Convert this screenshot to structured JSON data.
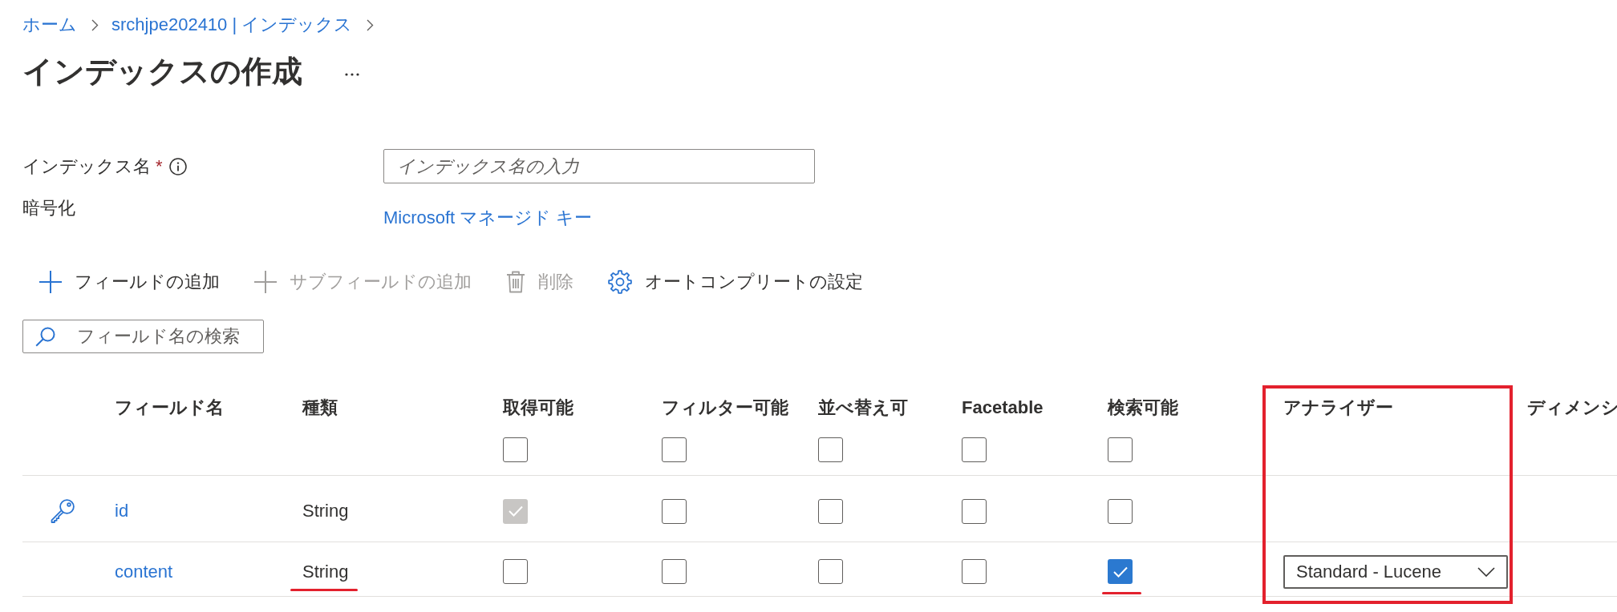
{
  "breadcrumb": [
    {
      "label": "ホーム"
    },
    {
      "label": "srchjpe202410 | インデックス"
    }
  ],
  "title": "インデックスの作成",
  "form": {
    "index_name": {
      "label": "インデックス名",
      "required_mark": "*",
      "placeholder": "インデックス名の入力"
    },
    "encryption": {
      "label": "暗号化",
      "link": "Microsoft マネージド キー"
    }
  },
  "toolbar": [
    {
      "kind": "add",
      "label": "フィールドの追加",
      "disabled": false
    },
    {
      "kind": "add",
      "label": "サブフィールドの追加",
      "disabled": true
    },
    {
      "kind": "delete",
      "label": "削除",
      "disabled": true
    },
    {
      "kind": "settings",
      "label": "オートコンプリートの設定",
      "disabled": false
    }
  ],
  "search": {
    "placeholder": "フィールド名の検索"
  },
  "table": {
    "columns": [
      {
        "label": "フィールド名",
        "kind": "name",
        "highlighted": false
      },
      {
        "label": "種類",
        "kind": "type",
        "highlighted": false
      },
      {
        "label": "取得可能",
        "kind": "checkbox",
        "checked": false,
        "highlighted": false
      },
      {
        "label": "フィルター可能",
        "kind": "checkbox",
        "checked": false,
        "highlighted": false
      },
      {
        "label": "並べ替え可",
        "kind": "checkbox",
        "checked": false,
        "highlighted": false
      },
      {
        "label": "Facetable",
        "kind": "checkbox",
        "checked": false,
        "highlighted": false
      },
      {
        "label": "検索可能",
        "kind": "checkbox",
        "checked": false,
        "highlighted": false
      },
      {
        "label": "アナライザー",
        "kind": "analyzer",
        "highlighted": true
      },
      {
        "label": "ディメンシ",
        "kind": "dimension",
        "highlighted": false
      }
    ],
    "rows": [
      {
        "key": true,
        "name": "id",
        "type": "String",
        "type_underlined": false,
        "flags": [
          {
            "checked": true,
            "disabled": true,
            "underlined": false
          },
          {
            "checked": false,
            "disabled": false,
            "underlined": false
          },
          {
            "checked": false,
            "disabled": false,
            "underlined": false
          },
          {
            "checked": false,
            "disabled": false,
            "underlined": false
          },
          {
            "checked": false,
            "disabled": false,
            "underlined": false
          }
        ]
      },
      {
        "key": false,
        "name": "content",
        "type": "String",
        "type_underlined": true,
        "flags": [
          {
            "checked": false,
            "disabled": false,
            "underlined": false
          },
          {
            "checked": false,
            "disabled": false,
            "underlined": false
          },
          {
            "checked": false,
            "disabled": false,
            "underlined": false
          },
          {
            "checked": false,
            "disabled": false,
            "underlined": false
          },
          {
            "checked": true,
            "disabled": false,
            "underlined": true
          }
        ],
        "analyzer": "Standard - Lucene"
      }
    ]
  }
}
